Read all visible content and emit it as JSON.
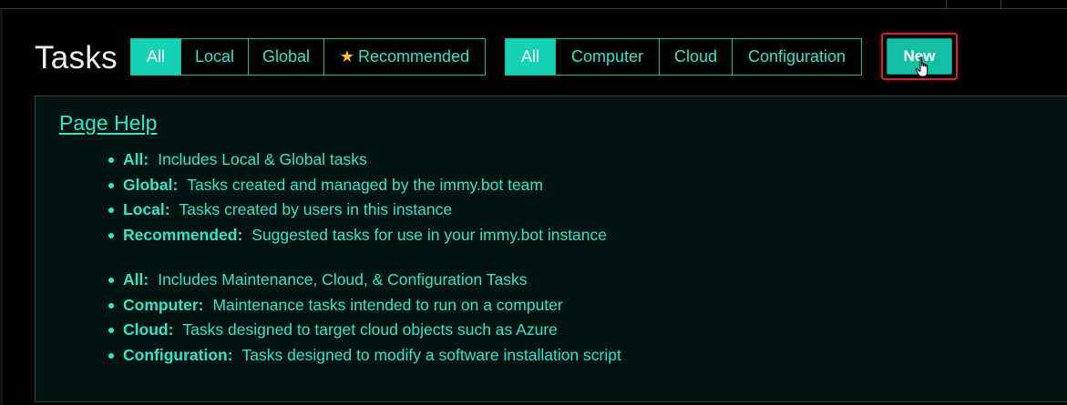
{
  "page": {
    "title": "Tasks"
  },
  "scope_filter": {
    "items": [
      {
        "label": "All",
        "active": true
      },
      {
        "label": "Local",
        "active": false
      },
      {
        "label": "Global",
        "active": false
      },
      {
        "label": "Recommended",
        "active": false,
        "icon": "star-icon"
      }
    ]
  },
  "type_filter": {
    "items": [
      {
        "label": "All",
        "active": true
      },
      {
        "label": "Computer",
        "active": false
      },
      {
        "label": "Cloud",
        "active": false
      },
      {
        "label": "Configuration",
        "active": false
      }
    ]
  },
  "new_button": {
    "label": "New"
  },
  "help": {
    "title": "Page Help",
    "scope_items": [
      {
        "term": "All:",
        "desc": "Includes Local & Global tasks"
      },
      {
        "term": "Global:",
        "desc": "Tasks created and managed by the immy.bot team"
      },
      {
        "term": "Local:",
        "desc": "Tasks created by users in this instance"
      },
      {
        "term": "Recommended:",
        "desc": "Suggested tasks for use in your immy.bot instance"
      }
    ],
    "type_items": [
      {
        "term": "All:",
        "desc": "Includes Maintenance, Cloud, & Configuration Tasks"
      },
      {
        "term": "Computer:",
        "desc": "Maintenance tasks intended to run on a computer"
      },
      {
        "term": "Cloud:",
        "desc": "Tasks designed to target cloud objects such as Azure"
      },
      {
        "term": "Configuration:",
        "desc": "Tasks designed to modify a software installation script"
      }
    ]
  },
  "colors": {
    "accent": "#14d1b3",
    "text_accent": "#35e3c8",
    "background": "#000000",
    "panel_background": "#021412",
    "highlight_border": "#c12a3a"
  }
}
